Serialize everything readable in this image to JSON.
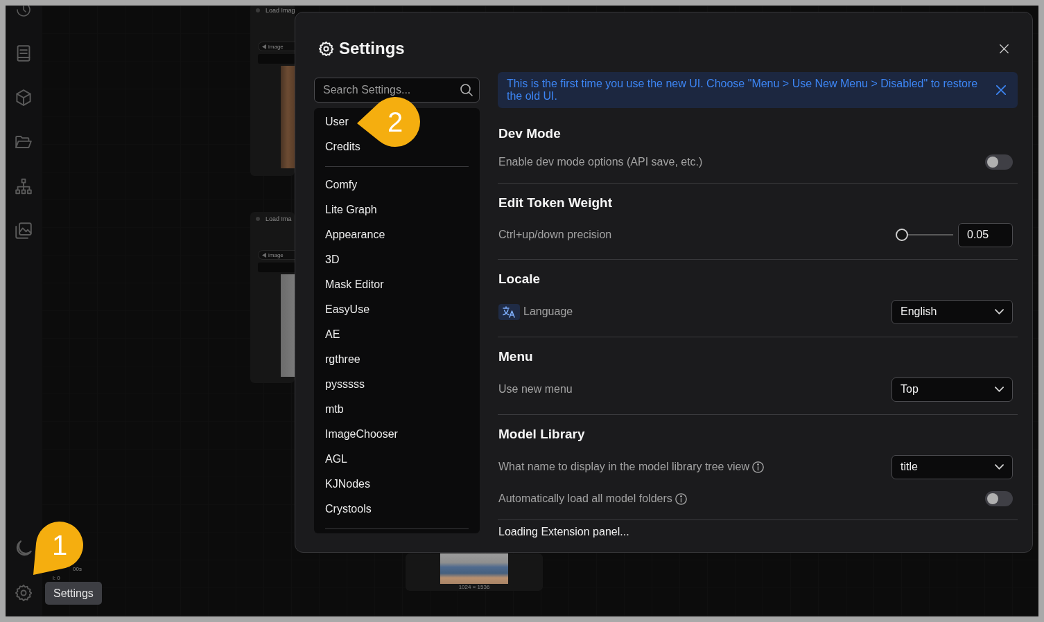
{
  "sidebar": {
    "tooltip": "Settings"
  },
  "canvas": {
    "nodes": [
      {
        "kind": "loader",
        "title": "Load Imag",
        "widget": "image"
      },
      {
        "kind": "loader",
        "title": "Load Ima",
        "widget": "image"
      },
      {
        "kind": "preview",
        "caption": "1024 × 1536"
      }
    ],
    "stats": [
      "00s",
      "l: 0"
    ]
  },
  "dialog": {
    "title": "Settings",
    "search": {
      "placeholder": "Search Settings..."
    },
    "nav_groups": [
      {
        "items": [
          {
            "label": "User",
            "selected": false
          },
          {
            "label": "Credits",
            "selected": false
          }
        ]
      },
      {
        "items": [
          {
            "label": "Comfy",
            "selected": false
          },
          {
            "label": "Lite Graph",
            "selected": false
          },
          {
            "label": "Appearance",
            "selected": false
          },
          {
            "label": "3D",
            "selected": false
          },
          {
            "label": "Mask Editor",
            "selected": false
          },
          {
            "label": "EasyUse",
            "selected": false
          },
          {
            "label": "AE",
            "selected": false
          },
          {
            "label": "rgthree",
            "selected": false
          },
          {
            "label": "pysssss",
            "selected": false
          },
          {
            "label": "mtb",
            "selected": false
          },
          {
            "label": "ImageChooser",
            "selected": false
          },
          {
            "label": "AGL",
            "selected": false
          },
          {
            "label": "KJNodes",
            "selected": false
          },
          {
            "label": "Crystools",
            "selected": false
          }
        ]
      }
    ],
    "banner": {
      "text": "This is the first time you use the new UI. Choose \"Menu > Use New Menu > Disabled\" to restore the old UI."
    },
    "sections": [
      {
        "title": "Dev Mode",
        "settings": [
          {
            "kind": "toggle",
            "label": "Enable dev mode options (API save, etc.)",
            "info": false,
            "on": false
          }
        ]
      },
      {
        "title": "Edit Token Weight",
        "settings": [
          {
            "kind": "slider",
            "label": "Ctrl+up/down precision",
            "info": false,
            "level": 0,
            "value": "0.05"
          }
        ]
      },
      {
        "title": "Locale",
        "settings": [
          {
            "kind": "language_select",
            "label": "Language",
            "info": false,
            "value": "English"
          }
        ]
      },
      {
        "title": "Menu",
        "settings": [
          {
            "kind": "select",
            "label": "Use new menu",
            "info": false,
            "value": "Top"
          }
        ]
      },
      {
        "title": "Model Library",
        "settings": [
          {
            "kind": "select",
            "label": "What name to display in the model library tree view",
            "info": true,
            "value": "title"
          },
          {
            "kind": "toggle",
            "label": "Automatically load all model folders",
            "info": true,
            "on": false
          }
        ]
      }
    ],
    "status": "Loading Extension panel..."
  },
  "markers": [
    {
      "number": "1"
    },
    {
      "number": "2"
    }
  ]
}
